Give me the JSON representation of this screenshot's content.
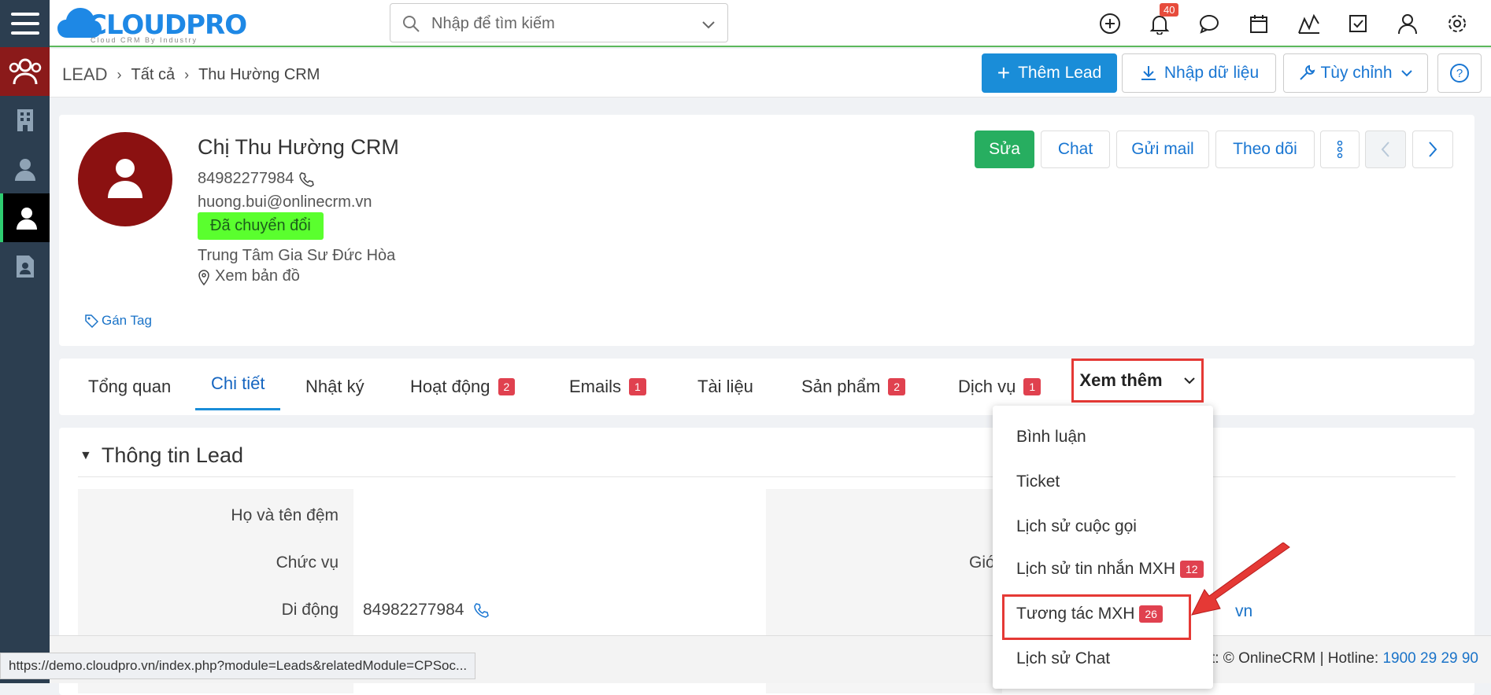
{
  "colors": {
    "accent": "#1a8dd8",
    "sidebar": "#2c3e50",
    "danger": "#e53935",
    "success": "#27ae60",
    "status_badge": "#5aff2e"
  },
  "logo": {
    "text": "CLOUDPRO",
    "sub": "Cloud CRM By Industry"
  },
  "search": {
    "placeholder": "Nhập để tìm kiếm"
  },
  "top_icons": [
    "plus-circle-icon",
    "bell-icon",
    "chat-icon",
    "calendar-icon",
    "report-icon",
    "task-icon",
    "user-icon",
    "gear-icon"
  ],
  "notifications": {
    "count": "40"
  },
  "sidebar": {
    "items": [
      "leads-icon",
      "building-icon",
      "contact-icon",
      "person-icon",
      "document-icon"
    ]
  },
  "breadcrumb": {
    "root": "LEAD",
    "items": [
      "Tất cả",
      "Thu Hường CRM"
    ]
  },
  "header_buttons": {
    "add": "Thêm Lead",
    "import": "Nhập dữ liệu",
    "customize": "Tùy chỉnh"
  },
  "profile": {
    "name": "Chị Thu Hường CRM",
    "phone": "84982277984",
    "email": "huong.bui@onlinecrm.vn",
    "status": "Đã chuyển đổi",
    "company": "Trung Tâm Gia Sư Đức Hòa",
    "map": "Xem bản đồ",
    "tag": "Gán Tag"
  },
  "actions": {
    "edit": "Sửa",
    "chat": "Chat",
    "mail": "Gửi mail",
    "follow": "Theo dõi"
  },
  "tabs": [
    {
      "label": "Tổng quan"
    },
    {
      "label": "Chi tiết"
    },
    {
      "label": "Nhật ký"
    },
    {
      "label": "Hoạt động",
      "badge": "2"
    },
    {
      "label": "Emails",
      "badge": "1"
    },
    {
      "label": "Tài liệu"
    },
    {
      "label": "Sản phẩm",
      "badge": "2"
    },
    {
      "label": "Dịch vụ",
      "badge": "1"
    }
  ],
  "more_tab": {
    "label": "Xem thêm"
  },
  "dropdown": [
    {
      "label": "Bình luận"
    },
    {
      "label": "Ticket"
    },
    {
      "label": "Lịch sử cuộc gọi"
    },
    {
      "label": "Lịch sử tin nhắn MXH",
      "badge": "12"
    },
    {
      "label": "Tương tác MXH",
      "badge": "26"
    },
    {
      "label": "Lịch sử Chat"
    }
  ],
  "section": {
    "title": "Thông tin Lead",
    "fields": [
      {
        "label": "Họ và tên đệm",
        "value": ""
      },
      {
        "label": "Chức vụ",
        "value": ""
      },
      {
        "label": "Di động",
        "value": "84982277984"
      }
    ],
    "right_partial": "Giớ",
    "right_email_tail": "vn"
  },
  "footer": {
    "copyright": "t: © OnlineCRM",
    "hotline_label": "Hotline:",
    "hotline": "1900 29 29 90"
  },
  "status_url": "https://demo.cloudpro.vn/index.php?module=Leads&relatedModule=CPSoc..."
}
